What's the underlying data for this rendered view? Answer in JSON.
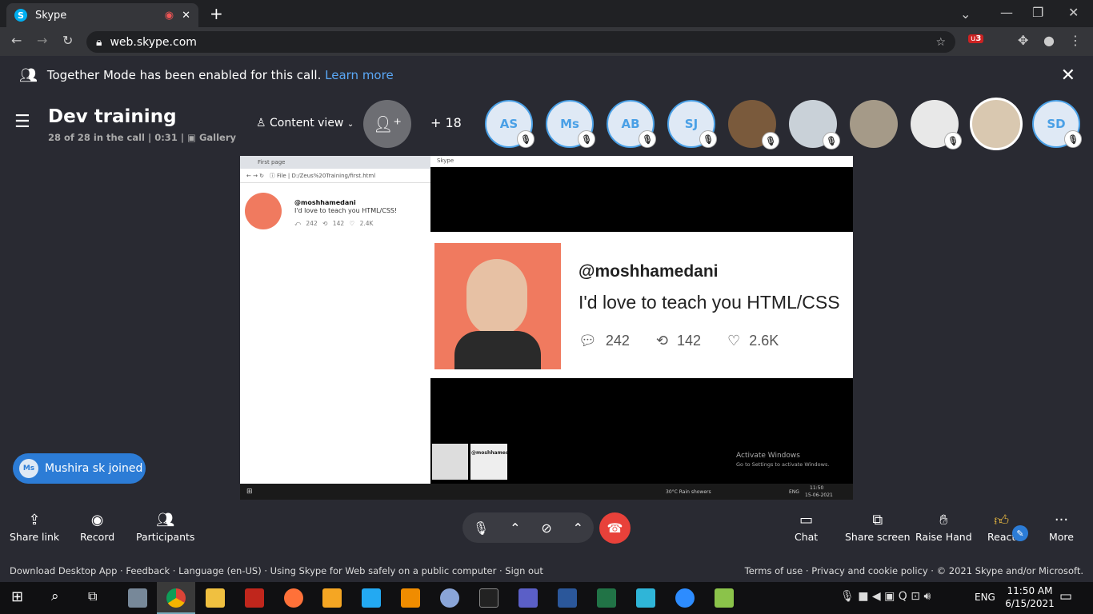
{
  "browser": {
    "tab_title": "Skype",
    "url": "web.skype.com",
    "extension_badge": "3"
  },
  "notice": {
    "text": "Together Mode has been enabled for this call.",
    "link": "Learn more"
  },
  "call": {
    "title": "Dev training",
    "status": "28 of 28 in the call | 0:31 |",
    "view_mode": "Gallery",
    "content_view": "Content view",
    "more_count": "+ 18"
  },
  "participants": [
    {
      "initials": "AS"
    },
    {
      "initials": "Ms"
    },
    {
      "initials": "AB"
    },
    {
      "initials": "SJ"
    },
    {
      "initials": ""
    },
    {
      "initials": ""
    },
    {
      "initials": ""
    },
    {
      "initials": ""
    },
    {
      "initials": ""
    },
    {
      "initials": "SD"
    }
  ],
  "shared": {
    "tab": "First page",
    "file_label": "File",
    "path": "D:/Zeus%20Training/first.html",
    "handle": "@moshhamedani",
    "tweet": "I'd love to teach you HTML/CSS!",
    "tweet_big": "I'd love to teach you HTML/CSS",
    "replies": "242",
    "retweets": "142",
    "likes_small": "2.4K",
    "likes_big": "2.6K",
    "inner_window": "Skype",
    "activate_title": "Activate Windows",
    "activate_sub": "Go to Settings to activate Windows.",
    "weather": "30°C Rain showers",
    "inner_time": "11:50",
    "inner_date": "15-06-2021",
    "inner_lang": "ENG"
  },
  "toast": {
    "initials": "Ms",
    "text": "Mushira sk joined"
  },
  "controls": {
    "share_link": "Share link",
    "record": "Record",
    "participants": "Participants",
    "chat": "Chat",
    "share_screen": "Share screen",
    "raise_hand": "Raise Hand",
    "react": "React",
    "more": "More"
  },
  "footer": {
    "left": [
      "Download Desktop App",
      "Feedback",
      "Language (en-US)",
      "Using Skype for Web safely on a public computer",
      "Sign out"
    ],
    "right": [
      "Terms of use",
      "Privacy and cookie policy",
      "© 2021 Skype and/or Microsoft."
    ]
  },
  "taskbar": {
    "lang": "ENG",
    "time": "11:50 AM",
    "date": "6/15/2021"
  }
}
